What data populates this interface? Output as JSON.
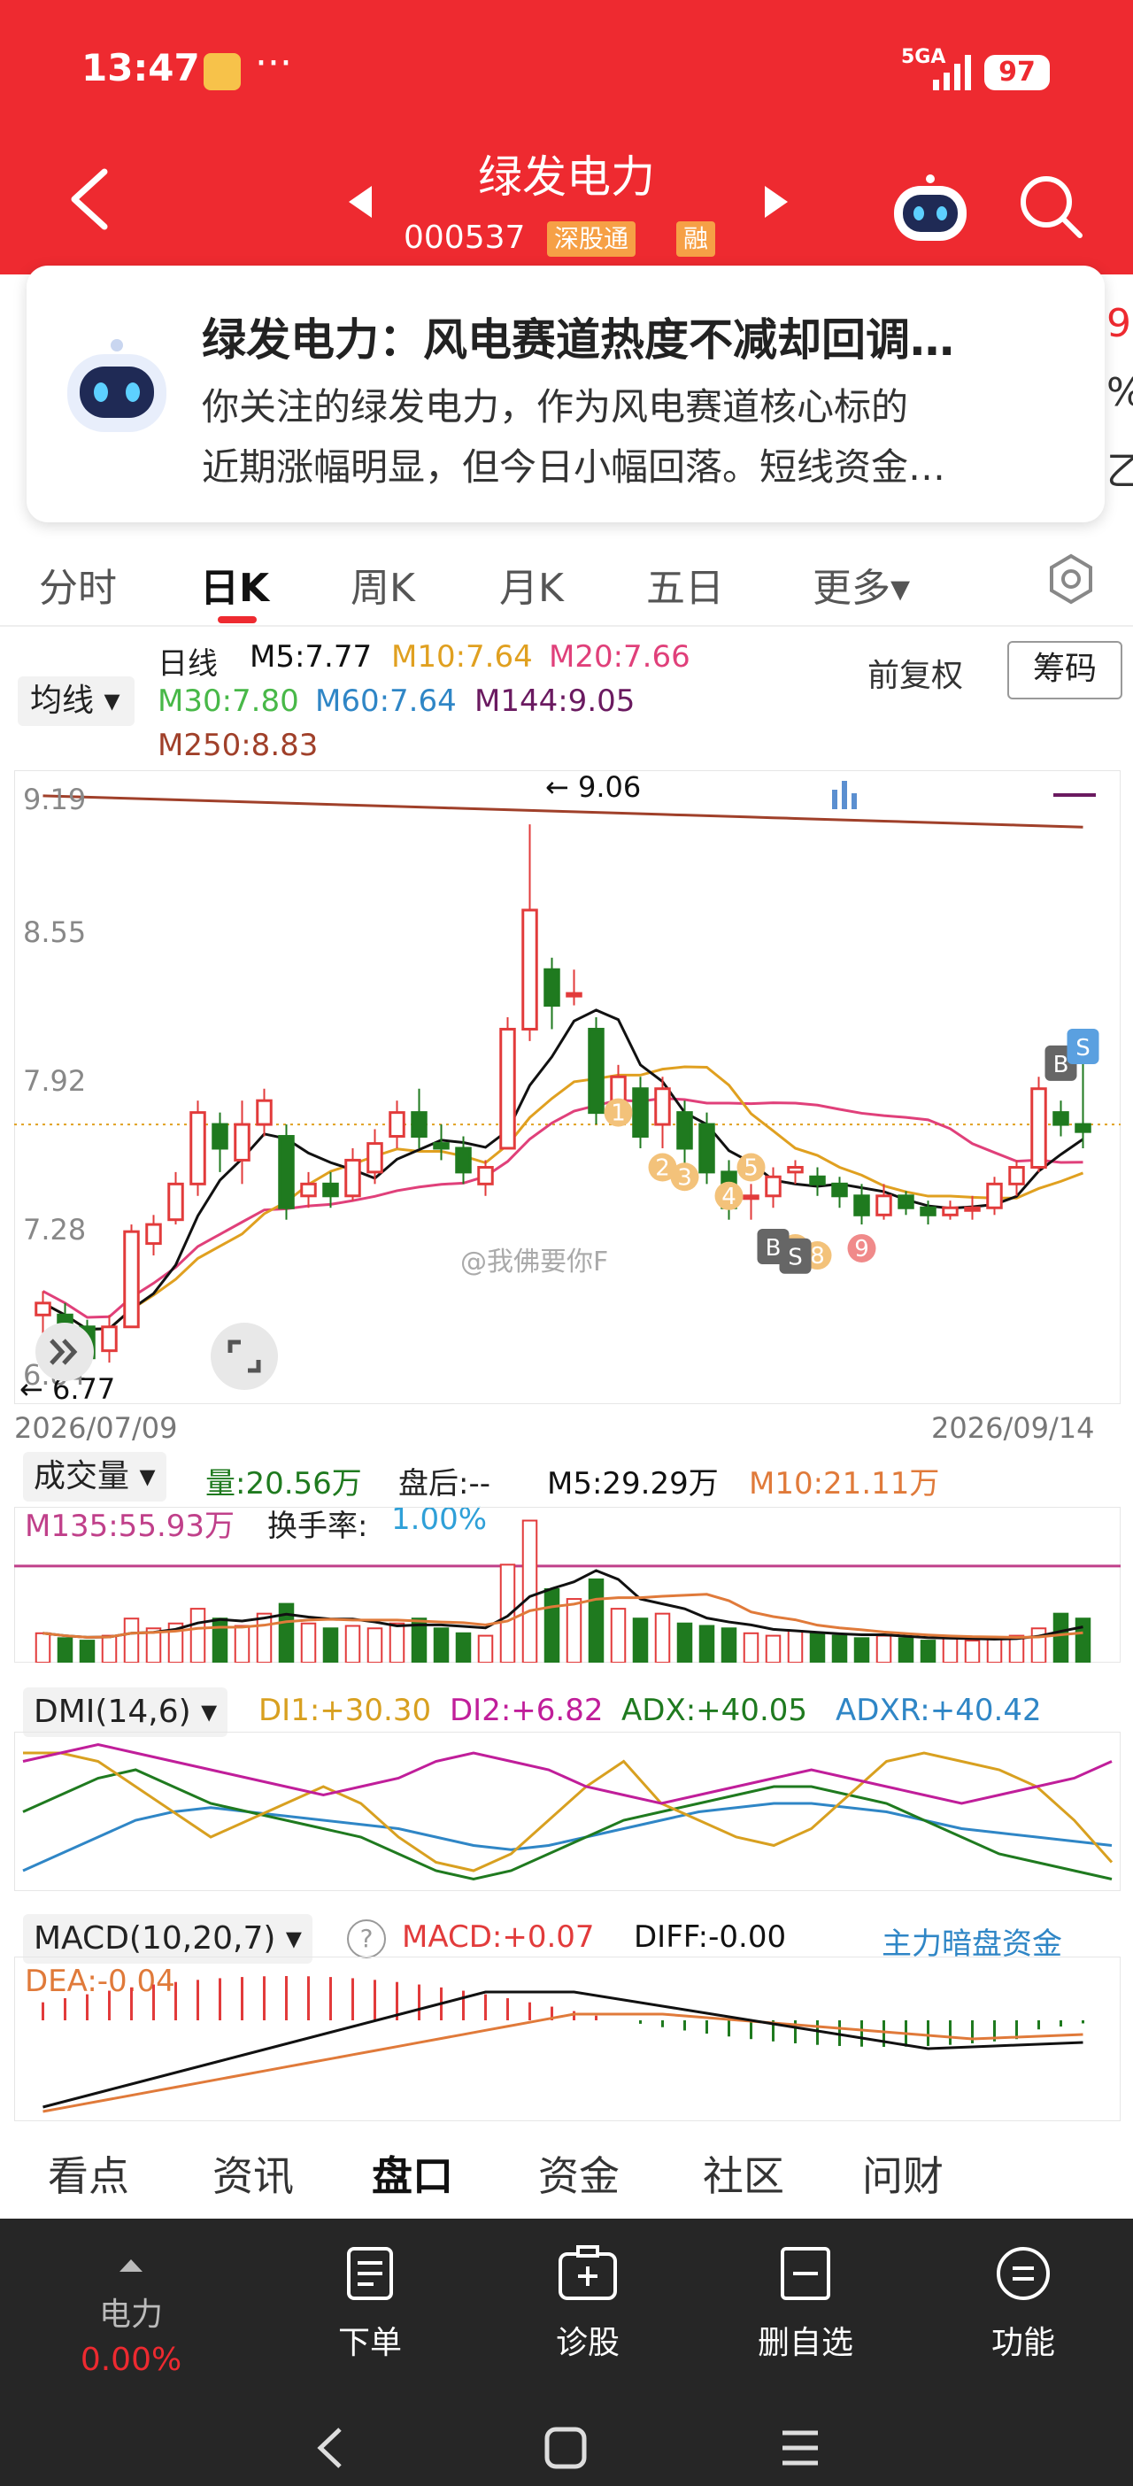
{
  "status": {
    "time": "13:47",
    "signal": "5GA",
    "battery": "97",
    "more": "···"
  },
  "header": {
    "name": "绿发电力",
    "code": "000537",
    "tags": [
      "深股通",
      "融"
    ]
  },
  "news": {
    "title": "绿发电力：风电赛道热度不减却回调…",
    "line1": "你关注的绿发电力，作为风电赛道核心标的",
    "line2": "近期涨幅明显，但今日小幅回落。短线资金…",
    "peek": [
      "9",
      "%",
      "乙"
    ]
  },
  "tabs": [
    "分时",
    "日K",
    "周K",
    "月K",
    "五日",
    "更多▾"
  ],
  "ma_legend": {
    "dropdown": "均线 ▾",
    "period": "日线",
    "m5": "M5:7.77",
    "m10": "M10:7.64",
    "m20": "M20:7.66",
    "m30": "M30:7.80",
    "m60": "M60:7.64",
    "m144": "M144:9.05",
    "m250": "M250:8.83",
    "fuquan": "前复权",
    "chouma": "筹码"
  },
  "colors": {
    "m5": "#111111",
    "m10": "#e0a020",
    "m20": "#e0407a",
    "m30": "#48b848",
    "m60": "#2f86c6",
    "m144": "#6a1a60",
    "m250": "#a0402a",
    "up": "#e23b3b",
    "down": "#1f7a1f"
  },
  "chart_data": {
    "type": "candlestick",
    "x_range": [
      "2026/07/09",
      "2026/09/14"
    ],
    "y_ticks": [
      "9.19",
      "8.55",
      "7.92",
      "7.28",
      "6.84"
    ],
    "high_annotation": "← 9.06",
    "low_annotation": "← 6.77",
    "watermark": "@我佛要你F",
    "signal_marks": [
      "1",
      "2",
      "3",
      "4",
      "5",
      "6",
      "7",
      "8",
      "9",
      "B",
      "S"
    ],
    "candles": [
      [
        7.0,
        7.05,
        6.85,
        7.1
      ],
      [
        7.0,
        6.95,
        6.85,
        7.05
      ],
      [
        6.95,
        6.82,
        6.78,
        6.98
      ],
      [
        6.85,
        6.95,
        6.8,
        7.0
      ],
      [
        6.95,
        7.35,
        6.95,
        7.38
      ],
      [
        7.3,
        7.38,
        7.25,
        7.42
      ],
      [
        7.4,
        7.55,
        7.38,
        7.6
      ],
      [
        7.55,
        7.85,
        7.5,
        7.9
      ],
      [
        7.8,
        7.7,
        7.6,
        7.85
      ],
      [
        7.65,
        7.8,
        7.55,
        7.9
      ],
      [
        7.8,
        7.9,
        7.75,
        7.95
      ],
      [
        7.75,
        7.45,
        7.4,
        7.8
      ],
      [
        7.5,
        7.55,
        7.45,
        7.6
      ],
      [
        7.55,
        7.5,
        7.45,
        7.6
      ],
      [
        7.5,
        7.65,
        7.48,
        7.7
      ],
      [
        7.6,
        7.72,
        7.55,
        7.78
      ],
      [
        7.75,
        7.85,
        7.7,
        7.9
      ],
      [
        7.85,
        7.75,
        7.7,
        7.95
      ],
      [
        7.72,
        7.7,
        7.65,
        7.8
      ],
      [
        7.7,
        7.6,
        7.55,
        7.75
      ],
      [
        7.55,
        7.62,
        7.5,
        7.65
      ],
      [
        7.7,
        8.2,
        7.7,
        8.25
      ],
      [
        8.2,
        8.7,
        8.15,
        9.06
      ],
      [
        8.45,
        8.3,
        8.2,
        8.5
      ],
      [
        8.35,
        8.35,
        8.3,
        8.45
      ],
      [
        8.2,
        7.85,
        7.8,
        8.25
      ],
      [
        7.9,
        8.0,
        7.85,
        8.05
      ],
      [
        7.95,
        7.75,
        7.7,
        8.0
      ],
      [
        7.8,
        7.95,
        7.7,
        8.0
      ],
      [
        7.85,
        7.7,
        7.6,
        7.9
      ],
      [
        7.8,
        7.6,
        7.55,
        7.85
      ],
      [
        7.6,
        7.45,
        7.4,
        7.65
      ],
      [
        7.5,
        7.5,
        7.4,
        7.55
      ],
      [
        7.5,
        7.58,
        7.45,
        7.62
      ],
      [
        7.6,
        7.62,
        7.55,
        7.65
      ],
      [
        7.58,
        7.55,
        7.5,
        7.62
      ],
      [
        7.55,
        7.5,
        7.45,
        7.58
      ],
      [
        7.5,
        7.42,
        7.38,
        7.55
      ],
      [
        7.42,
        7.5,
        7.4,
        7.55
      ],
      [
        7.5,
        7.45,
        7.42,
        7.52
      ],
      [
        7.45,
        7.42,
        7.38,
        7.48
      ],
      [
        7.42,
        7.45,
        7.4,
        7.48
      ],
      [
        7.45,
        7.45,
        7.4,
        7.5
      ],
      [
        7.45,
        7.55,
        7.42,
        7.58
      ],
      [
        7.55,
        7.62,
        7.5,
        7.65
      ],
      [
        7.62,
        7.95,
        7.6,
        8.0
      ],
      [
        7.85,
        7.8,
        7.75,
        7.9
      ],
      [
        7.8,
        7.77,
        7.7,
        8.2
      ]
    ],
    "volume_panel": {
      "dropdown": "成交量 ▾",
      "vol": "量:20.56万",
      "after": "盘后:--",
      "m5": "M5:29.29万",
      "m10": "M10:21.11万",
      "m135": "M135:55.93万",
      "turnover_label": "换手率:",
      "turnover": "1.00%"
    },
    "volumes": [
      12,
      10,
      9,
      11,
      18,
      14,
      16,
      22,
      18,
      15,
      20,
      24,
      16,
      14,
      15,
      14,
      16,
      18,
      14,
      12,
      11,
      40,
      58,
      30,
      26,
      34,
      22,
      18,
      20,
      16,
      15,
      14,
      12,
      11,
      13,
      12,
      11,
      10,
      11,
      10,
      9,
      10,
      9,
      10,
      11,
      14,
      20,
      18
    ],
    "dmi_panel": {
      "dropdown": "DMI(14,6) ▾",
      "di1": "DI1:+30.30",
      "di2": "DI2:+6.82",
      "adx": "ADX:+40.05",
      "adxr": "ADXR:+40.42"
    },
    "macd_panel": {
      "dropdown": "MACD(10,20,7) ▾",
      "help": "?",
      "macd": "MACD:+0.07",
      "diff": "DIFF:-0.00",
      "dea": "DEA:-0.04",
      "link": "主力暗盘资金"
    }
  },
  "segment_tabs": [
    "看点",
    "资讯",
    "盘口",
    "资金",
    "社区",
    "问财"
  ],
  "bottom_bar": {
    "sector_name": "电力",
    "sector_change": "0.00%",
    "buy": "下单",
    "diagnose": "诊股",
    "remove": "删自选",
    "more": "功能"
  }
}
